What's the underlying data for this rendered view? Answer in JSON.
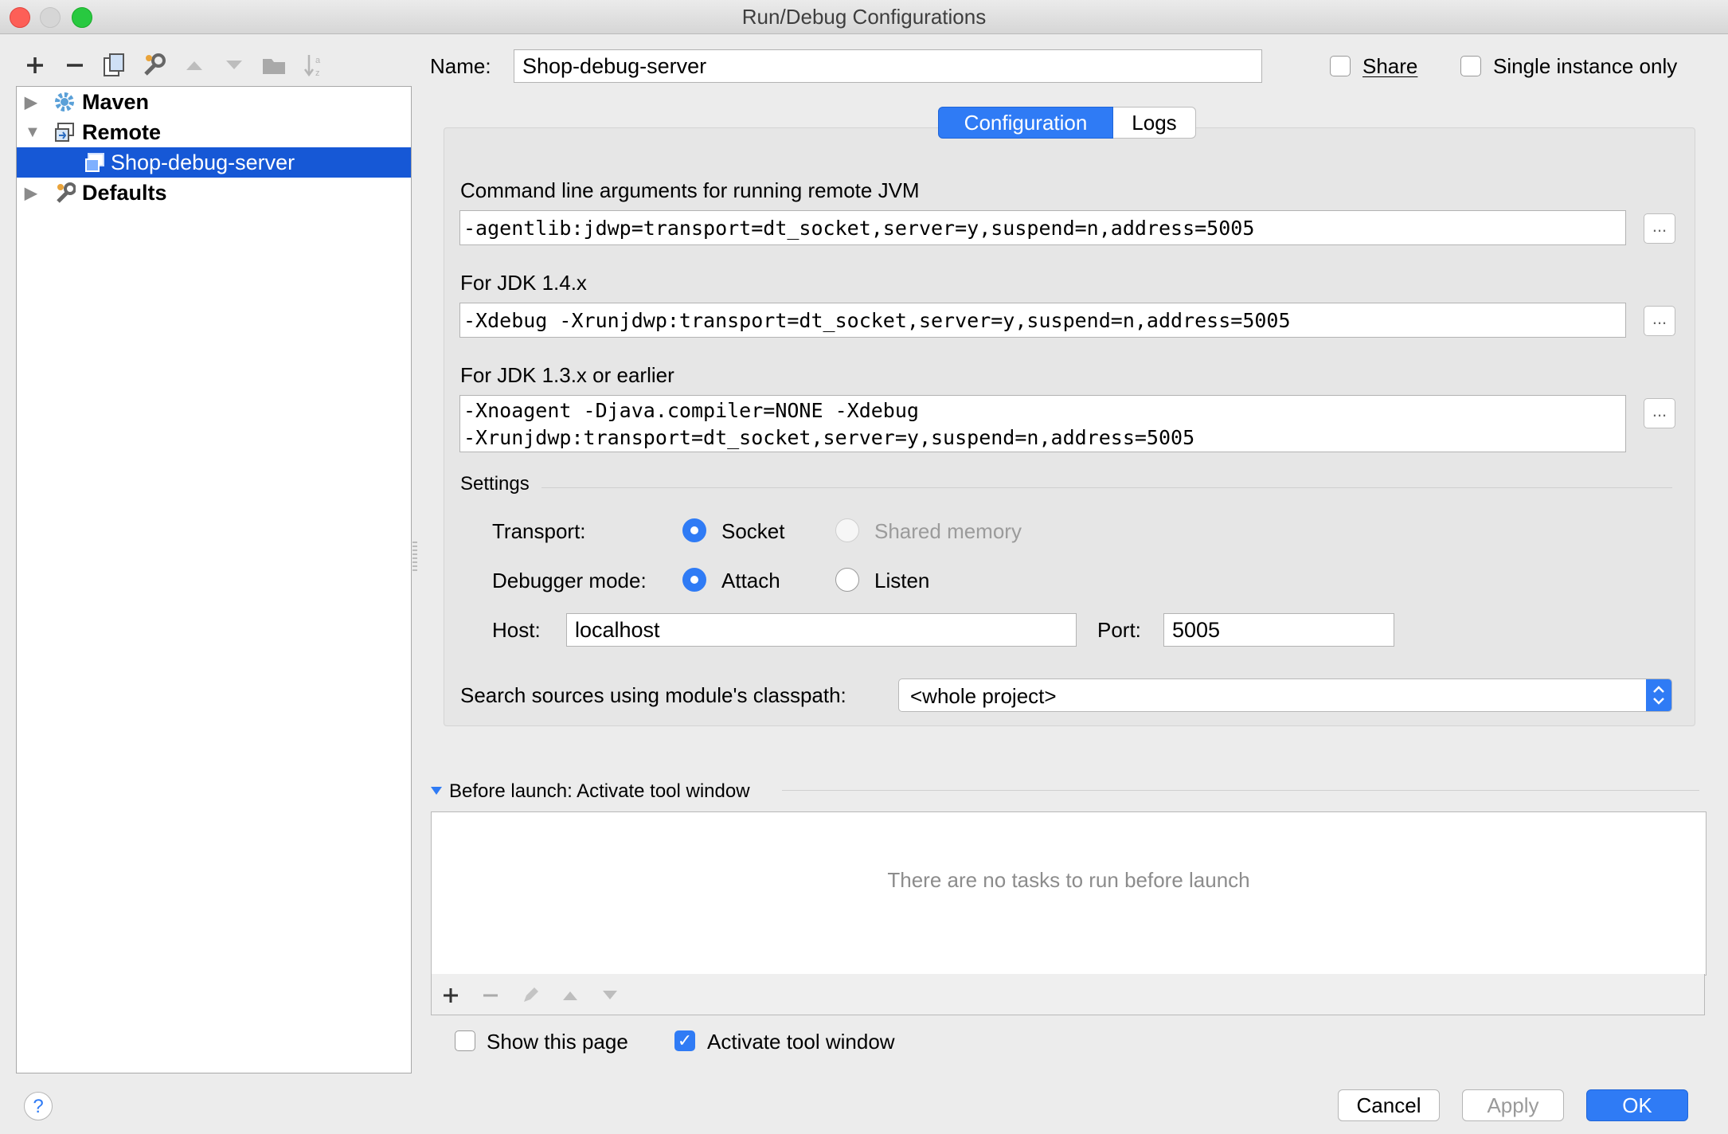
{
  "window": {
    "title": "Run/Debug Configurations"
  },
  "toolbar": {
    "items": [
      "add-icon",
      "remove-icon",
      "copy-icon",
      "edit-defaults-icon",
      "move-up-icon",
      "move-down-icon",
      "folder-icon",
      "sort-icon"
    ]
  },
  "tree": {
    "items": [
      {
        "label": "Maven",
        "icon": "maven-gear-icon",
        "expanded": false
      },
      {
        "label": "Remote",
        "icon": "remote-icon",
        "expanded": true
      },
      {
        "label": "Shop-debug-server",
        "icon": "remote-config-icon",
        "selected": true
      },
      {
        "label": "Defaults",
        "icon": "wrench-icon",
        "expanded": false
      }
    ]
  },
  "name": {
    "label": "Name:",
    "value": "Shop-debug-server"
  },
  "share": {
    "label": "Share",
    "checked": false
  },
  "single_instance": {
    "label": "Single instance only",
    "checked": false
  },
  "tabs": [
    {
      "label": "Configuration",
      "active": true
    },
    {
      "label": "Logs",
      "active": false
    }
  ],
  "config": {
    "cmd_label": "Command line arguments for running remote JVM",
    "cmd_value": "-agentlib:jdwp=transport=dt_socket,server=y,suspend=n,address=5005",
    "jdk14_label": "For JDK 1.4.x",
    "jdk14_value": "-Xdebug -Xrunjdwp:transport=dt_socket,server=y,suspend=n,address=5005",
    "jdk13_label": "For JDK 1.3.x or earlier",
    "jdk13_value_line1": "-Xnoagent -Djava.compiler=NONE -Xdebug",
    "jdk13_value_line2": "-Xrunjdwp:transport=dt_socket,server=y,suspend=n,address=5005",
    "dots": "..."
  },
  "settings": {
    "title": "Settings",
    "transport_label": "Transport:",
    "transport_socket": "Socket",
    "transport_shared": "Shared memory",
    "debugger_label": "Debugger mode:",
    "debugger_attach": "Attach",
    "debugger_listen": "Listen",
    "host_label": "Host:",
    "host_value": "localhost",
    "port_label": "Port:",
    "port_value": "5005",
    "classpath_label": "Search sources using module's classpath:",
    "classpath_value": "<whole project>"
  },
  "before_launch": {
    "title": "Before launch: Activate tool window",
    "empty_text": "There are no tasks to run before launch",
    "toolbar": [
      "add-icon",
      "remove-icon",
      "edit-icon",
      "move-up-icon",
      "move-down-icon"
    ]
  },
  "show_page": {
    "label": "Show this page",
    "checked": false
  },
  "activate_tool": {
    "label": "Activate tool window",
    "checked": true
  },
  "buttons": {
    "help": "?",
    "cancel": "Cancel",
    "apply": "Apply",
    "ok": "OK"
  },
  "colors": {
    "accent": "#2f7bf5",
    "selection": "#1658d6"
  }
}
